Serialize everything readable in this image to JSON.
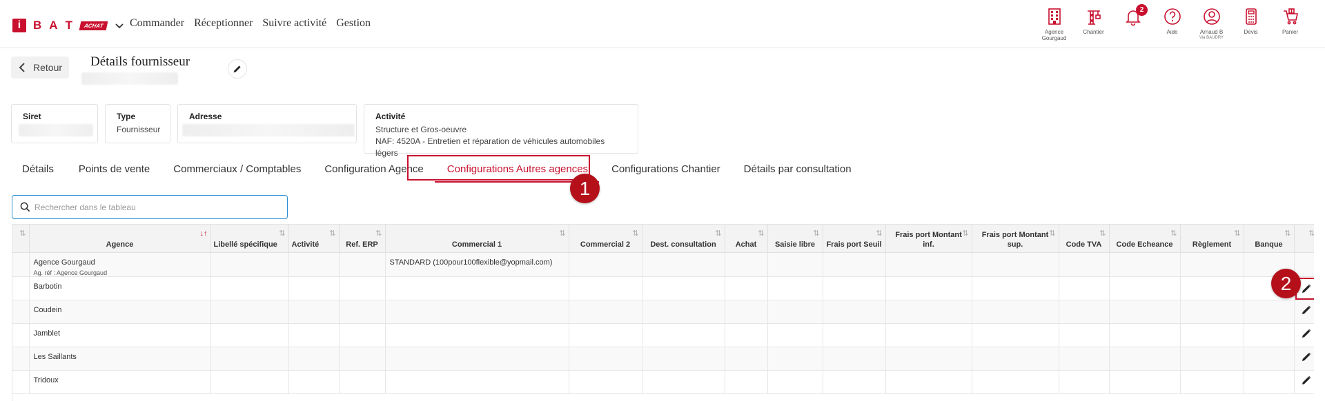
{
  "logo": {
    "letters": [
      "B",
      "A",
      "T"
    ],
    "i": "i",
    "badge": "ACHAT"
  },
  "nav": [
    "Commander",
    "Réceptionner",
    "Suivre activité",
    "Gestion"
  ],
  "header_icons": [
    {
      "name": "agence",
      "label": "Agence",
      "sub": "Gourgaud"
    },
    {
      "name": "chantier",
      "label": "Chantier",
      "sub": ""
    },
    {
      "name": "notifications",
      "label": "",
      "sub": "",
      "badge": "2"
    },
    {
      "name": "aide",
      "label": "Aide",
      "sub": ""
    },
    {
      "name": "user",
      "label": "Arnaud B",
      "sub": "Via BAUDRY"
    },
    {
      "name": "devis",
      "label": "Devis",
      "sub": ""
    },
    {
      "name": "panier",
      "label": "Panier",
      "sub": ""
    }
  ],
  "page": {
    "back_label": "Retour",
    "title": "Détails fournisseur"
  },
  "cards": {
    "siret": {
      "label": "Siret"
    },
    "type": {
      "label": "Type",
      "value": "Fournisseur"
    },
    "adresse": {
      "label": "Adresse"
    },
    "activite": {
      "label": "Activité",
      "line1": "Structure et Gros-oeuvre",
      "line2": "NAF: 4520A - Entretien et réparation de véhicules automobiles légers"
    }
  },
  "tabs": [
    "Détails",
    "Points de vente",
    "Commerciaux / Comptables",
    "Configuration Agence",
    "Configurations Autres agences",
    "Configurations Chantier",
    "Détails par consultation"
  ],
  "active_tab": "Configurations Autres agences",
  "markers": [
    "1",
    "2"
  ],
  "search": {
    "placeholder": "Rechercher dans le tableau"
  },
  "table": {
    "columns": [
      {
        "label": "",
        "width": 24
      },
      {
        "label": "Agence",
        "width": 263,
        "sort_active": true
      },
      {
        "label": "Libellé spécifique",
        "width": 113
      },
      {
        "label": "Activité",
        "width": 73
      },
      {
        "label": "Ref. ERP",
        "width": 67
      },
      {
        "label": "Commercial 1",
        "width": 266
      },
      {
        "label": "Commercial 2",
        "width": 106
      },
      {
        "label": "Dest. consultation",
        "width": 120
      },
      {
        "label": "Achat",
        "width": 62
      },
      {
        "label": "Saisie libre",
        "width": 80
      },
      {
        "label": "Frais port Seuil",
        "width": 91
      },
      {
        "label": "Frais port Montant inf.",
        "width": 125
      },
      {
        "label": "Frais port Montant sup.",
        "width": 126
      },
      {
        "label": "Code TVA",
        "width": 73
      },
      {
        "label": "Code Echeance",
        "width": 103
      },
      {
        "label": "Règlement",
        "width": 92
      },
      {
        "label": "Banque",
        "width": 73
      },
      {
        "label": "",
        "width": 35
      }
    ],
    "rows": [
      {
        "agence": "Agence Gourgaud",
        "agence_ref": "Ag. réf : Agence Gourgaud",
        "commercial1": "STANDARD (100pour100flexible@yopmail.com)"
      },
      {
        "agence": "Barbotin",
        "agence_ref": "",
        "commercial1": ""
      },
      {
        "agence": "Coudein",
        "agence_ref": "",
        "commercial1": ""
      },
      {
        "agence": "Jamblet",
        "agence_ref": "",
        "commercial1": ""
      },
      {
        "agence": "Les Saillants",
        "agence_ref": "",
        "commercial1": ""
      },
      {
        "agence": "Tridoux",
        "agence_ref": "",
        "commercial1": ""
      }
    ]
  },
  "colors": {
    "brand": "#c8102e",
    "search_border": "#2a8fd6"
  }
}
